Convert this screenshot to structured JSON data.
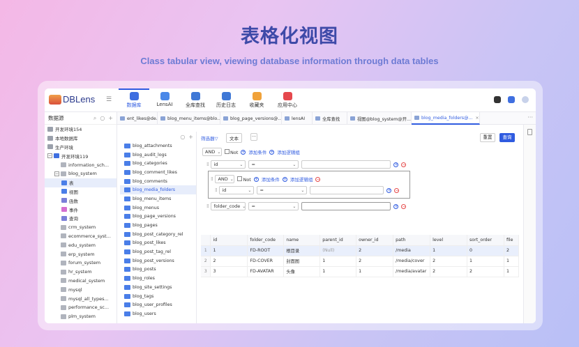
{
  "hero": {
    "title": "表格化视图",
    "subtitle": "Class tabular view, viewing database information through data tables"
  },
  "app": {
    "logo": "DBLens",
    "nav": [
      {
        "label": "数据库",
        "color": "#3f6fe0",
        "active": true
      },
      {
        "label": "LensAI",
        "color": "#4a88e8",
        "active": false
      },
      {
        "label": "全库查找",
        "color": "#3f78d6",
        "active": false
      },
      {
        "label": "历史日志",
        "color": "#3f78d6",
        "active": false
      },
      {
        "label": "收藏夹",
        "color": "#f0a23a",
        "active": false
      },
      {
        "label": "应用中心",
        "color": "#e5484d",
        "active": false
      }
    ]
  },
  "sidebar": {
    "title": "数据源",
    "icons": [
      "search-icon",
      "refresh-icon",
      "add-icon"
    ],
    "tree": [
      {
        "label": "开发环境154",
        "level": 0,
        "type": "env"
      },
      {
        "label": "本地数据库",
        "level": 0,
        "type": "env"
      },
      {
        "label": "生产环境",
        "level": 0,
        "type": "env"
      },
      {
        "label": "开发环境119",
        "level": 0,
        "type": "env-open",
        "toggle": "−"
      },
      {
        "label": "information_sch...",
        "level": 1,
        "type": "db"
      },
      {
        "label": "blog_system",
        "level": 1,
        "type": "db",
        "toggle": "−"
      },
      {
        "label": "表",
        "level": 2,
        "type": "table-folder",
        "selected": true
      },
      {
        "label": "视图",
        "level": 2,
        "type": "view"
      },
      {
        "label": "函数",
        "level": 2,
        "type": "func"
      },
      {
        "label": "事件",
        "level": 2,
        "type": "event"
      },
      {
        "label": "查询",
        "level": 2,
        "type": "query"
      },
      {
        "label": "crm_system",
        "level": 1,
        "type": "db"
      },
      {
        "label": "ecommerce_syst...",
        "level": 1,
        "type": "db"
      },
      {
        "label": "edu_system",
        "level": 1,
        "type": "db"
      },
      {
        "label": "erp_system",
        "level": 1,
        "type": "db"
      },
      {
        "label": "forum_system",
        "level": 1,
        "type": "db"
      },
      {
        "label": "hr_system",
        "level": 1,
        "type": "db"
      },
      {
        "label": "medical_system",
        "level": 1,
        "type": "db"
      },
      {
        "label": "mysql",
        "level": 1,
        "type": "db"
      },
      {
        "label": "mysql_all_types...",
        "level": 1,
        "type": "db"
      },
      {
        "label": "performance_sc...",
        "level": 1,
        "type": "db"
      },
      {
        "label": "plm_system",
        "level": 1,
        "type": "db"
      }
    ]
  },
  "tables": [
    "blog_attachments",
    "blog_audit_logs",
    "blog_categories",
    "blog_comment_likes",
    "blog_comments",
    "blog_media_folders",
    "blog_menu_items",
    "blog_menus",
    "blog_page_versions",
    "blog_pages",
    "blog_post_category_rel",
    "blog_post_likes",
    "blog_post_tag_rel",
    "blog_post_versions",
    "blog_posts",
    "blog_roles",
    "blog_site_settings",
    "blog_tags",
    "blog_user_profiles",
    "blog_users"
  ],
  "selected_table": "blog_media_folders",
  "tabs": [
    {
      "label": "ent_likes@de...",
      "close": true,
      "active": false
    },
    {
      "label": "blog_menu_items@blo...",
      "close": true,
      "active": false
    },
    {
      "label": "blog_page_versions@...",
      "close": true,
      "active": false
    },
    {
      "label": "lensAI",
      "close": false,
      "active": false
    },
    {
      "label": "全库查找",
      "close": false,
      "active": false
    },
    {
      "label": "视图@blog_system@开...",
      "close": true,
      "active": false
    },
    {
      "label": "blog_media_folders@...",
      "close": true,
      "active": true
    }
  ],
  "tabs_more": "···",
  "filter": {
    "label": "筛选器▽",
    "mode": "文本",
    "mode_more": "···",
    "reset": "重置",
    "query": "查询",
    "root_op": "AND",
    "not_label": "Not",
    "add_cond": "添加条件",
    "add_group": "添加逻辑组",
    "c1": {
      "field": "id",
      "op": "=",
      "value": ""
    },
    "group": {
      "op": "AND",
      "not_label": "Not",
      "add_cond": "添加条件",
      "add_group": "添加逻辑组",
      "c": {
        "field": "id",
        "op": "=",
        "value": ""
      }
    },
    "c2": {
      "field": "folder_code",
      "op": "=",
      "value": ""
    }
  },
  "grid": {
    "columns": [
      "",
      "id",
      "folder_code",
      "name",
      "parent_id",
      "owner_id",
      "path",
      "level",
      "sort_order",
      "file"
    ],
    "rows": [
      [
        "1",
        "1",
        "FD-ROOT",
        "根目录",
        "(Null)",
        "2",
        "/media",
        "1",
        "0",
        "2"
      ],
      [
        "2",
        "2",
        "FD-COVER",
        "封面图",
        "1",
        "2",
        "/media/cover",
        "2",
        "1",
        "1"
      ],
      [
        "3",
        "3",
        "FD-AVATAR",
        "头像",
        "1",
        "1",
        "/media/avatar",
        "2",
        "2",
        "1"
      ]
    ]
  }
}
